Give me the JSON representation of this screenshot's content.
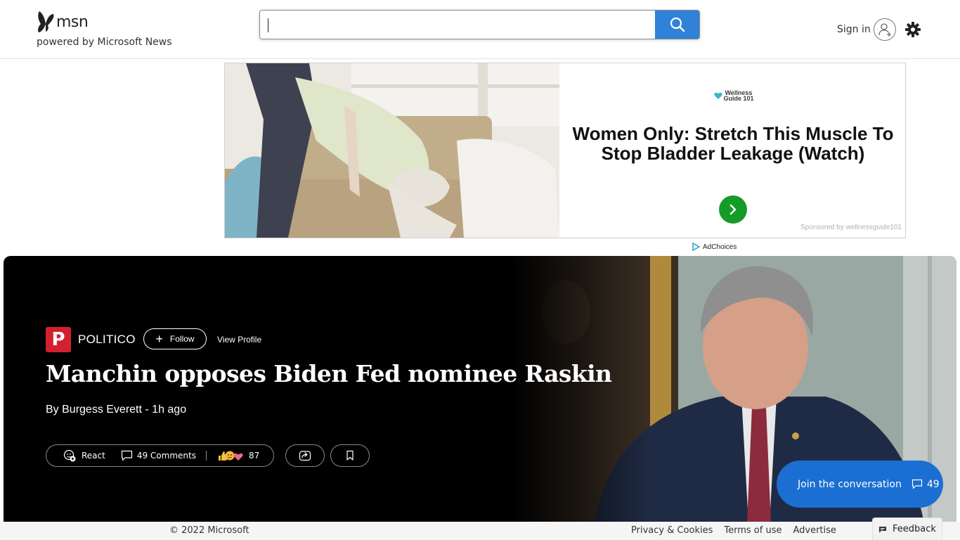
{
  "header": {
    "logo_text": "msn",
    "powered_by": "powered by Microsoft News",
    "search": {
      "value": "",
      "placeholder": ""
    },
    "sign_in": "Sign in",
    "icons": [
      "msn-butterfly-icon",
      "search-icon",
      "user-add-icon",
      "gear-icon"
    ]
  },
  "ad": {
    "brand": "Wellness Guide 101",
    "headline": "Women Only: Stretch This Muscle To Stop Bladder Leakage (Watch)",
    "sponsor": "Sponsored by wellnessguide101",
    "adchoices": "AdChoices",
    "cta_color": "#159b27"
  },
  "article": {
    "publisher": "POLITICO",
    "publisher_logo_letter": "P",
    "publisher_color": "#d3202f",
    "follow_label": "Follow",
    "view_profile": "View Profile",
    "headline": "Manchin opposes Biden Fed nominee Raskin",
    "byline": "By Burgess Everett - 1h ago",
    "actions": {
      "react_label": "React",
      "comments_label": "49 Comments",
      "reaction_count": "87"
    },
    "join": {
      "label": "Join the conversation",
      "count": "49",
      "color": "#1b6fd2"
    }
  },
  "footer": {
    "copyright": "© 2022 Microsoft",
    "links": [
      "Privacy & Cookies",
      "Terms of use",
      "Advertise"
    ],
    "feedback": "Feedback"
  }
}
